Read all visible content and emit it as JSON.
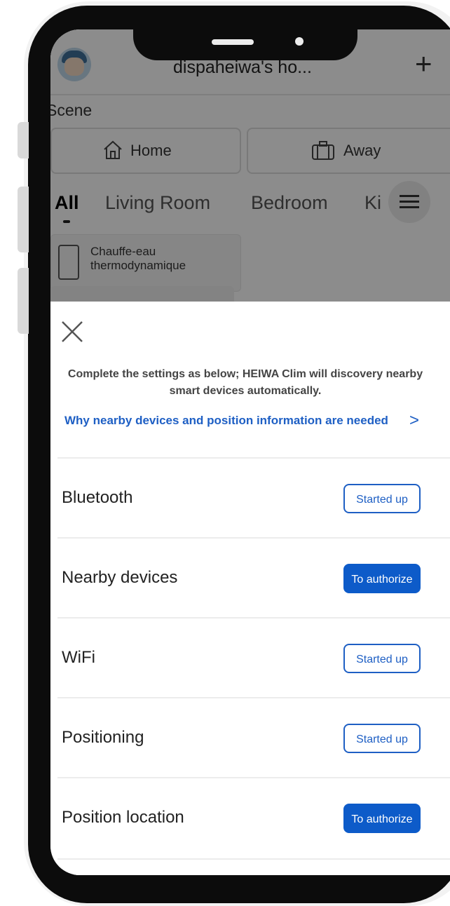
{
  "app": {
    "home_title": "dispaheiwa's ho...",
    "add_symbol": "+",
    "scene_label": "Scene",
    "scenes": [
      {
        "label": "Home",
        "icon": "home-icon"
      },
      {
        "label": "Away",
        "icon": "suitcase-icon"
      }
    ],
    "tabs": [
      {
        "label": "All",
        "active": true
      },
      {
        "label": "Living Room",
        "active": false
      },
      {
        "label": "Bedroom",
        "active": false
      },
      {
        "label": "Ki",
        "active": false
      }
    ],
    "device": {
      "name": "Chauffe-eau thermodynamique"
    }
  },
  "sheet": {
    "description": "Complete the settings as below; HEIWA Clim will discovery nearby smart devices automatically.",
    "why_link": "Why nearby devices and position information are needed",
    "why_chevron": ">",
    "permissions": [
      {
        "label": "Bluetooth",
        "status": "Started up",
        "style": "outline"
      },
      {
        "label": "Nearby devices",
        "status": "To authorize",
        "style": "filled"
      },
      {
        "label": "WiFi",
        "status": "Started up",
        "style": "outline"
      },
      {
        "label": "Positioning",
        "status": "Started up",
        "style": "outline"
      },
      {
        "label": "Position location",
        "status": "To authorize",
        "style": "filled"
      }
    ]
  },
  "colors": {
    "accent": "#1e5fc4",
    "accent_filled": "#0d5bc9",
    "frame": "#0c0c0c"
  }
}
